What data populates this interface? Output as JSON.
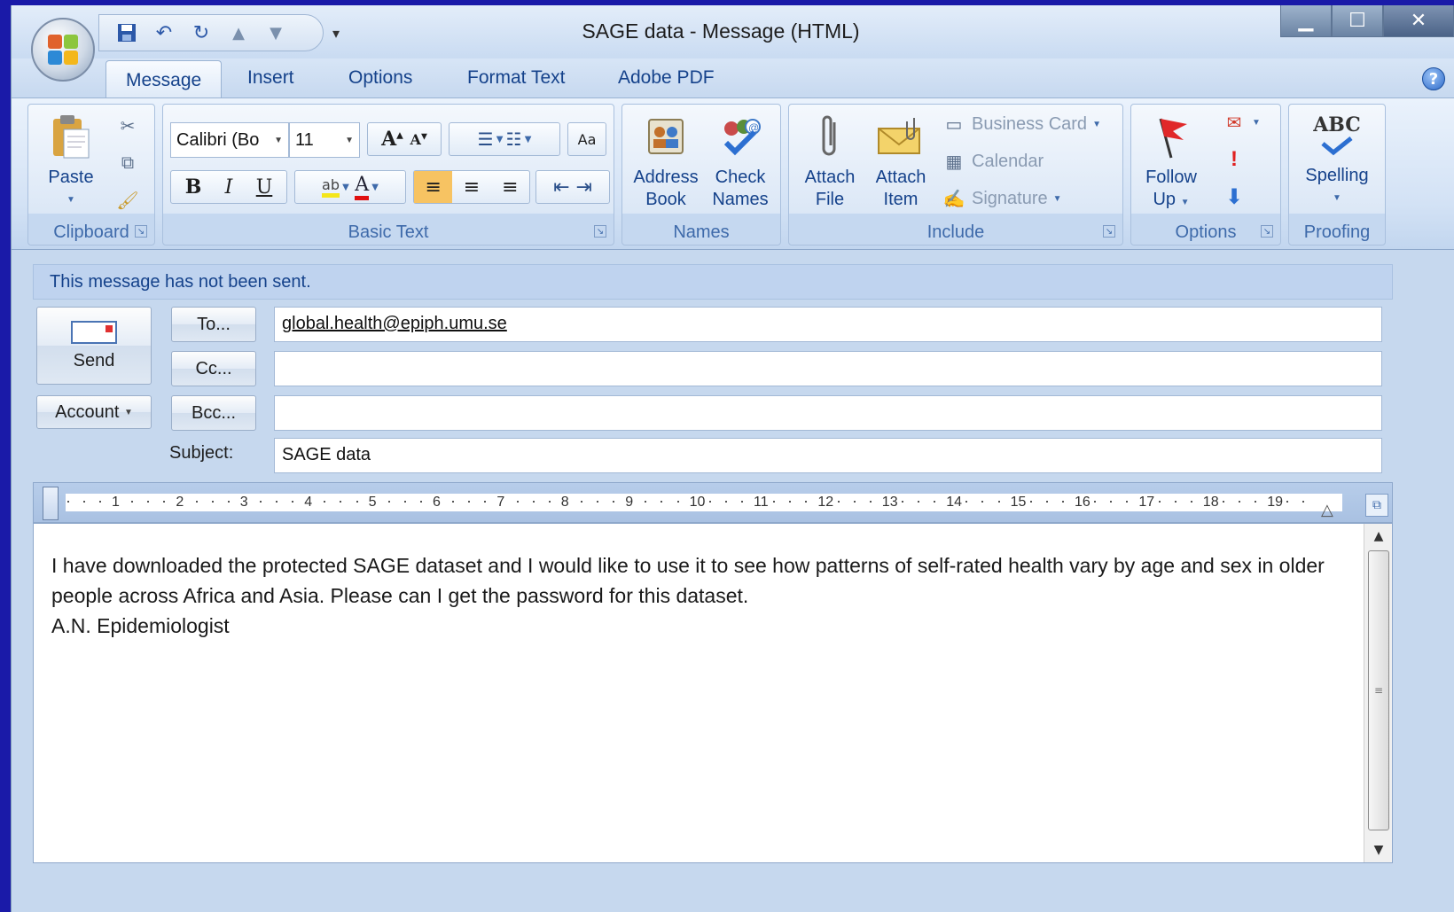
{
  "window": {
    "title": "SAGE data - Message (HTML)",
    "controls": {
      "minimize": "▁",
      "maximize": "☐",
      "close": "✕"
    }
  },
  "quick_access": {
    "icons": [
      "save-icon",
      "undo-icon",
      "redo-icon",
      "previous-item-icon",
      "next-item-icon"
    ],
    "more": "▾"
  },
  "tabs": [
    "Message",
    "Insert",
    "Options",
    "Format Text",
    "Adobe PDF"
  ],
  "ribbon": {
    "clipboard": {
      "label": "Clipboard",
      "paste": "Paste"
    },
    "basic_text": {
      "label": "Basic Text",
      "font_name": "Calibri (Bo",
      "font_size": "11"
    },
    "names": {
      "label": "Names",
      "address_book": [
        "Address",
        "Book"
      ],
      "check_names": [
        "Check",
        "Names"
      ]
    },
    "include": {
      "label": "Include",
      "attach_file": [
        "Attach",
        "File"
      ],
      "attach_item": [
        "Attach",
        "Item"
      ],
      "business_card": "Business Card",
      "calendar": "Calendar",
      "signature": "Signature"
    },
    "options": {
      "label": "Options",
      "follow_up": [
        "Follow",
        "Up"
      ]
    },
    "proofing": {
      "label": "Proofing",
      "spelling": "Spelling",
      "abc": "ABC"
    }
  },
  "message": {
    "info_bar": "This message has not been sent.",
    "send_label": "Send",
    "to_button": "To...",
    "cc_button": "Cc...",
    "bcc_button": "Bcc...",
    "account_button": "Account",
    "subject_label": "Subject:",
    "to_value": "global.health@epiph.umu.se",
    "cc_value": "",
    "bcc_value": "",
    "subject_value": "SAGE data",
    "body_paragraph": "I have downloaded the protected SAGE dataset and I would like to use it to see how patterns of self-rated health vary by age and sex in older people across Africa and Asia. Please can I get the password for this dataset.",
    "signature": "A.N. Epidemiologist"
  },
  "ruler": {
    "numbers": [
      "1",
      "2",
      "3",
      "4",
      "5",
      "6",
      "7",
      "8",
      "9",
      "10",
      "11",
      "12",
      "13",
      "14",
      "15",
      "16",
      "17",
      "18",
      "19"
    ]
  }
}
